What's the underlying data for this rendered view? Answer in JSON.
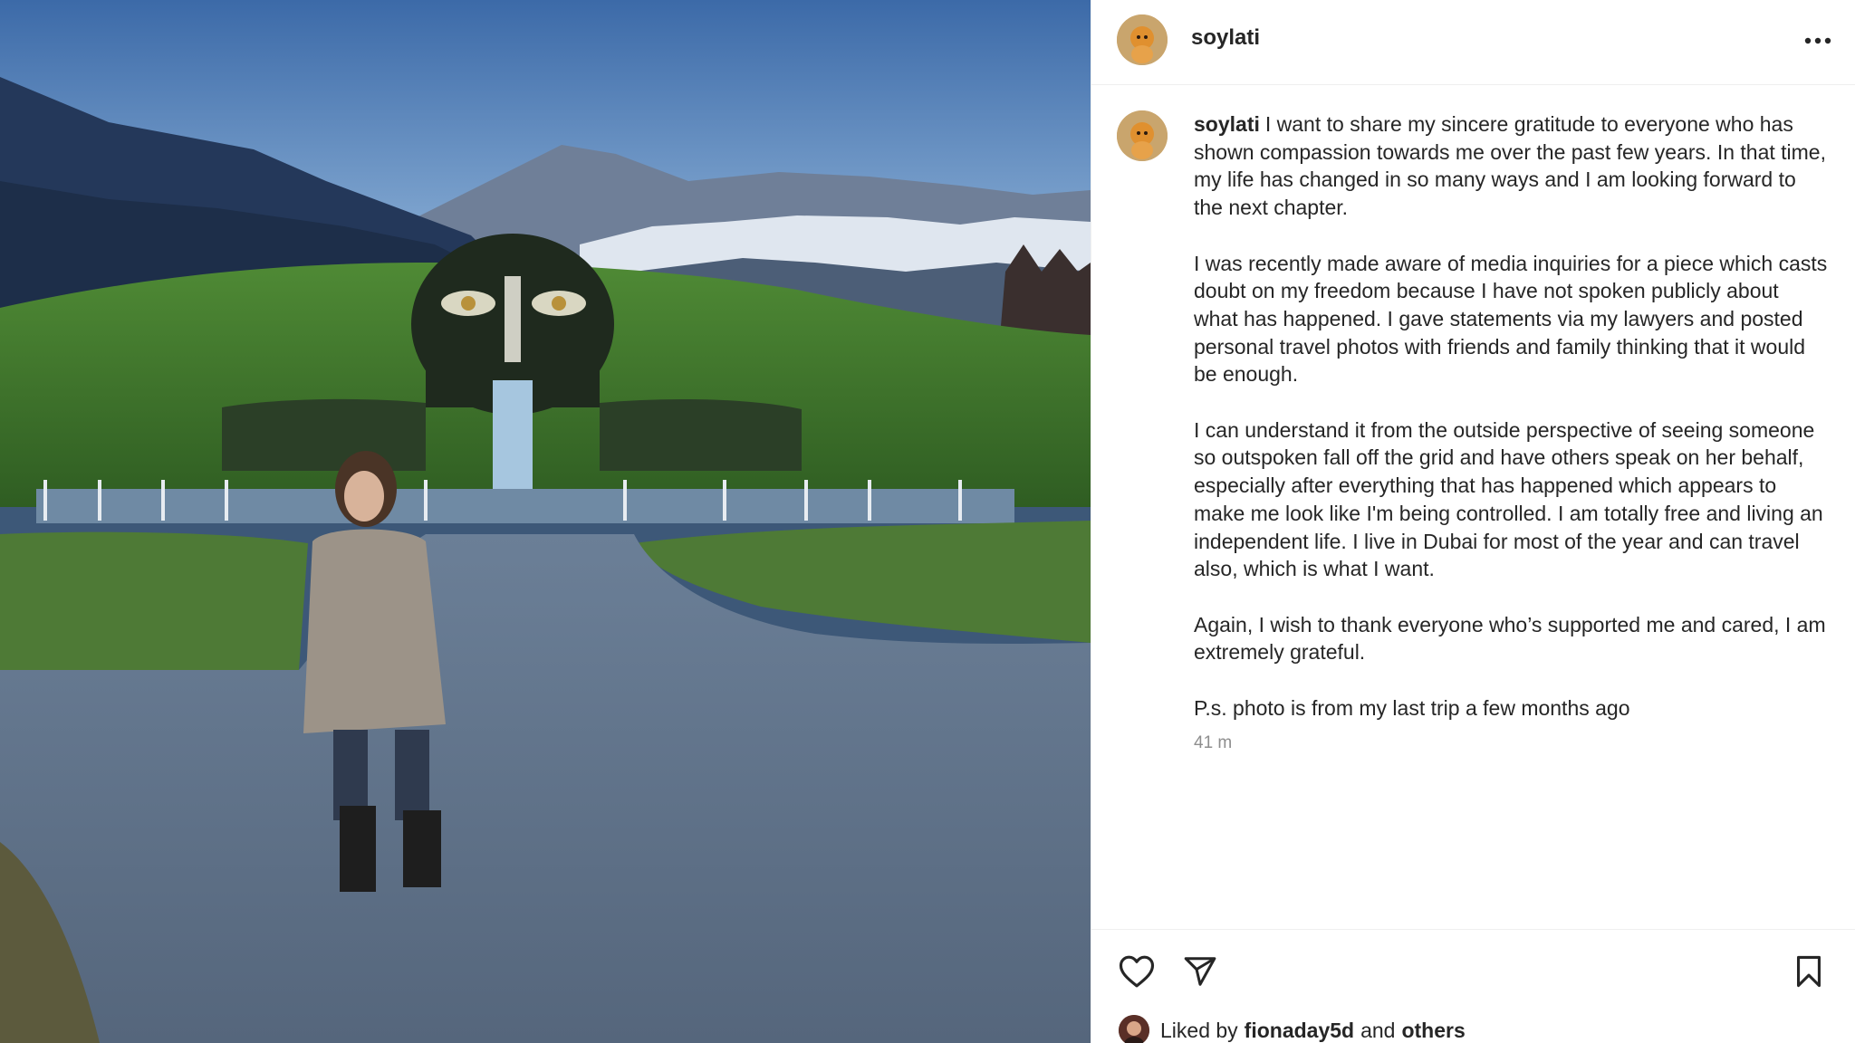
{
  "post": {
    "author": "soylati",
    "more_icon": "more-horizontal-icon"
  },
  "caption": {
    "username": "soylati",
    "paragraphs": [
      "I want to share my sincere gratitude to everyone who has shown compassion towards me over the past few years. In that time, my life has changed in so many ways and I am looking forward to the next chapter.",
      "I was recently made aware of media inquiries for a piece which casts doubt on my freedom because I have not spoken publicly about what has happened. I gave statements via my lawyers and posted personal travel photos with friends and family thinking that it would be enough.",
      "I can understand it from the outside perspective of seeing someone so outspoken fall off the grid and have others speak on her behalf, especially after everything that has happened which appears to make me look like I'm being controlled. I am totally free and living an independent life. I live in Dubai for most of the year and can travel also, which is what I want.",
      "Again, I wish to thank everyone who’s supported me and cared, I am extremely grateful.",
      "P.s. photo is from my last trip a few months ago"
    ],
    "timestamp": "41 m"
  },
  "actions": {
    "like_icon": "heart-icon",
    "share_icon": "paper-plane-icon",
    "save_icon": "bookmark-icon"
  },
  "likes": {
    "prefix": "Liked by",
    "user": "fionaday5d",
    "connector": "and",
    "others": "others"
  }
}
